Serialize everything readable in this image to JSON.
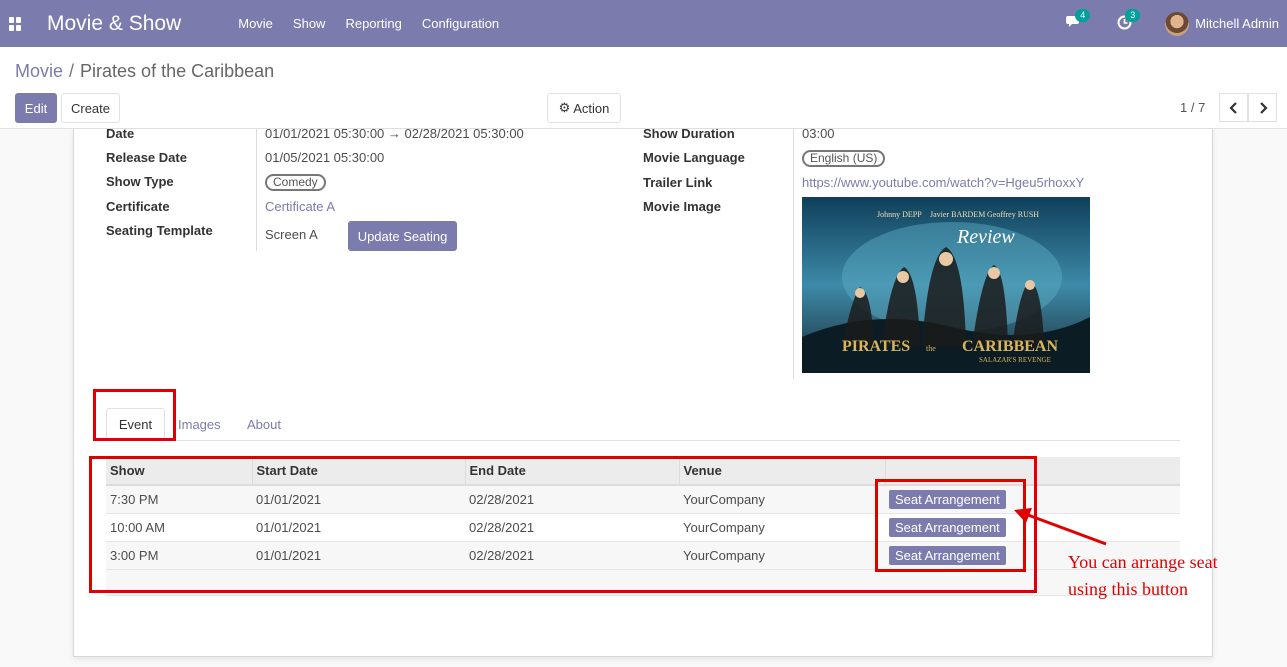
{
  "navbar": {
    "brand": "Movie & Show",
    "menu": [
      "Movie",
      "Show",
      "Reporting",
      "Configuration"
    ],
    "messages_count": "4",
    "activities_count": "3",
    "user_name": "Mitchell Admin"
  },
  "breadcrumb": {
    "parent": "Movie",
    "current": "Pirates of the Caribbean"
  },
  "buttons": {
    "edit": "Edit",
    "create": "Create",
    "action": "Action"
  },
  "pager": {
    "value": "1 / 7"
  },
  "form": {
    "left": {
      "date_label": "Date",
      "date_value": "01/01/2021 05:30:00 → 02/28/2021 05:30:00",
      "release_date_label": "Release Date",
      "release_date_value": "01/05/2021 05:30:00",
      "show_type_label": "Show Type",
      "show_type_value": "Comedy",
      "certificate_label": "Certificate",
      "certificate_value": "Certificate A",
      "seating_template_label": "Seating Template",
      "seating_template_value": "Screen A",
      "update_seating_button": "Update Seating"
    },
    "right": {
      "show_duration_label": "Show Duration",
      "show_duration_value": "03:00",
      "movie_language_label": "Movie Language",
      "movie_language_value": "English (US)",
      "trailer_link_label": "Trailer Link",
      "trailer_link_value": "https://www.youtube.com/watch?v=Hgeu5rhoxxY",
      "movie_image_label": "Movie Image"
    },
    "poster": {
      "title_line1": "PIRATES",
      "title_word_the": "the",
      "title_line2": "CARIBBEAN",
      "subtitle": "SALAZAR'S REVENGE",
      "review_text": "Review",
      "cast": [
        "Johnny DEPP",
        "Javier BARDEM",
        "Geoffrey RUSH"
      ]
    }
  },
  "tabs": [
    "Event",
    "Images",
    "About"
  ],
  "event_table": {
    "columns": [
      "Show",
      "Start Date",
      "End Date",
      "Venue",
      ""
    ],
    "button_label": "Seat Arrangement",
    "rows": [
      {
        "show": "7:30 PM",
        "start": "01/01/2021",
        "end": "02/28/2021",
        "venue": "YourCompany"
      },
      {
        "show": "10:00 AM",
        "start": "01/01/2021",
        "end": "02/28/2021",
        "venue": "YourCompany"
      },
      {
        "show": "3:00 PM",
        "start": "01/01/2021",
        "end": "02/28/2021",
        "venue": "YourCompany"
      }
    ]
  },
  "annotation": {
    "line1": "You can arrange seat",
    "line2": "using this button",
    "color": "#e00000"
  },
  "colors": {
    "brand": "#7c7bad",
    "badge": "#00a09d"
  }
}
